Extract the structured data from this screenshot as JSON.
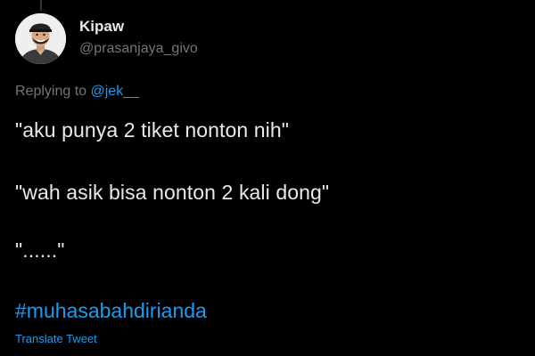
{
  "theme": {
    "background": "#000000",
    "text_primary": "#e7e9ea",
    "text_secondary": "#71767b",
    "accent": "#1d9bf0"
  },
  "author": {
    "display_name": "Kipaw",
    "handle": "@prasanjaya_givo",
    "avatar_icon": "profile-photo"
  },
  "reply": {
    "prefix": "Replying to ",
    "mention": "@jek__"
  },
  "tweet": {
    "lines": [
      "\"aku punya 2 tiket nonton nih\"",
      "\"wah asik bisa nonton 2 kali dong\"",
      "\"......\""
    ],
    "hashtag": "#muhasabahdirianda"
  },
  "actions": {
    "translate_label": "Translate Tweet"
  }
}
